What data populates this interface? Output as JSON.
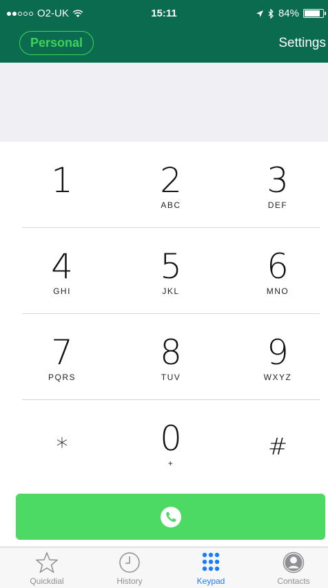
{
  "status_bar": {
    "carrier": "O2-UK",
    "time": "15:11",
    "battery": "84%",
    "battery_level": 0.84,
    "signal_bars_filled": 2,
    "signal_bars_total": 5
  },
  "header": {
    "account_label": "Personal",
    "settings_label": "Settings",
    "color": "#0b6b4e",
    "accent": "#3ed25b"
  },
  "display": {
    "number": ""
  },
  "keypad": {
    "keys": [
      {
        "digit": "1",
        "letters": ""
      },
      {
        "digit": "2",
        "letters": "ABC"
      },
      {
        "digit": "3",
        "letters": "DEF"
      },
      {
        "digit": "4",
        "letters": "GHI"
      },
      {
        "digit": "5",
        "letters": "JKL"
      },
      {
        "digit": "6",
        "letters": "MNO"
      },
      {
        "digit": "7",
        "letters": "PQRS"
      },
      {
        "digit": "8",
        "letters": "TUV"
      },
      {
        "digit": "9",
        "letters": "WXYZ"
      },
      {
        "digit": "*",
        "letters": ""
      },
      {
        "digit": "0",
        "letters": "+"
      },
      {
        "digit": "#",
        "letters": ""
      }
    ]
  },
  "call_button": {
    "icon": "phone-icon",
    "color": "#4cd964"
  },
  "tabbar": {
    "tabs": [
      {
        "label": "Quickdial",
        "icon": "star-icon",
        "active": false
      },
      {
        "label": "History",
        "icon": "clock-icon",
        "active": false
      },
      {
        "label": "Keypad",
        "icon": "keypad-icon",
        "active": true
      },
      {
        "label": "Contacts",
        "icon": "contact-icon",
        "active": false
      }
    ],
    "active_color": "#1a7dff"
  }
}
